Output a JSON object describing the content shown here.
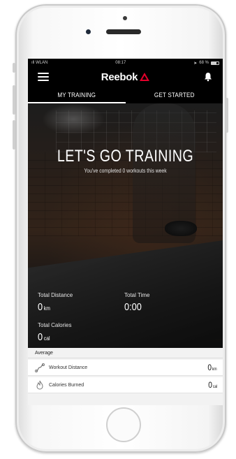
{
  "status_bar": {
    "carrier": "ıll WLAN",
    "time": "08:17",
    "battery_text": "68 %",
    "battery_level": 0.68
  },
  "header": {
    "brand": "Reebok",
    "menu_icon": "menu-icon",
    "notification_icon": "bell-icon"
  },
  "tabs": [
    {
      "label": "MY TRAINING",
      "active": true
    },
    {
      "label": "GET STARTED",
      "active": false
    }
  ],
  "hero": {
    "title": "LET'S GO TRAINING",
    "subtitle": "You've completed 0 workouts this week"
  },
  "stats": {
    "distance": {
      "label": "Total Distance",
      "value": "0",
      "unit": "km"
    },
    "time": {
      "label": "Total Time",
      "value": "0:00"
    },
    "calories": {
      "label": "Total Calories",
      "value": "0",
      "unit": "cal"
    }
  },
  "average": {
    "header": "Average",
    "rows": [
      {
        "label": "Workout Distance",
        "value": "0",
        "unit": "km",
        "icon": "route-icon"
      },
      {
        "label": "Calories Burned",
        "value": "0",
        "unit": "cal",
        "icon": "flame-icon"
      }
    ]
  },
  "colors": {
    "brand_red": "#e4002b",
    "background": "#000000"
  }
}
